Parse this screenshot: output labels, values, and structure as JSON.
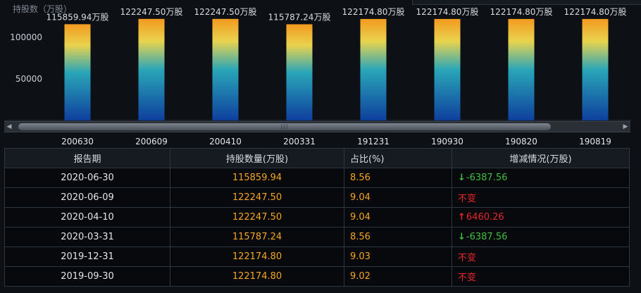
{
  "chart": {
    "unit_label": "持股数（万股）"
  },
  "chart_data": {
    "type": "bar",
    "categories": [
      "200630",
      "200609",
      "200410",
      "200331",
      "191231",
      "190930",
      "190820",
      "190819"
    ],
    "values": [
      115859.94,
      122247.5,
      122247.5,
      115787.24,
      122174.8,
      122174.8,
      122174.8,
      122174.8
    ],
    "data_labels": [
      "115859.94万股",
      "122247.50万股",
      "122247.50万股",
      "115787.24万股",
      "122174.80万股",
      "122174.80万股",
      "122174.80万股",
      "122174.80万股"
    ],
    "y_ticks": [
      50000,
      100000
    ],
    "y_tick_labels": [
      "50000",
      "100000"
    ],
    "ylim": [
      0,
      145000
    ],
    "grid": false
  },
  "table": {
    "headers": [
      "报告期",
      "持股数量(万股)",
      "占比(%)",
      "增减情况(万股)"
    ],
    "rows": [
      {
        "date": "2020-06-30",
        "shares": "115859.94",
        "ratio": "8.56",
        "change": "-6387.56",
        "dir": "down"
      },
      {
        "date": "2020-06-09",
        "shares": "122247.50",
        "ratio": "9.04",
        "change": "不变",
        "dir": "flat"
      },
      {
        "date": "2020-04-10",
        "shares": "122247.50",
        "ratio": "9.04",
        "change": "6460.26",
        "dir": "up"
      },
      {
        "date": "2020-03-31",
        "shares": "115787.24",
        "ratio": "8.56",
        "change": "-6387.56",
        "dir": "down"
      },
      {
        "date": "2019-12-31",
        "shares": "122174.80",
        "ratio": "9.03",
        "change": "不变",
        "dir": "flat"
      },
      {
        "date": "2019-09-30",
        "shares": "122174.80",
        "ratio": "9.02",
        "change": "不变",
        "dir": "flat"
      }
    ]
  },
  "colors": {
    "bar_top": "#f39a1f",
    "bar_mid": "#e6d64a",
    "bar_low": "#2aa6b8",
    "bar_bottom": "#0e3f9e",
    "up": "#e6262a",
    "down": "#3fbf3f",
    "value": "#f5a623"
  },
  "icons": {
    "down": "arrow-down-icon",
    "up": "arrow-up-icon"
  }
}
